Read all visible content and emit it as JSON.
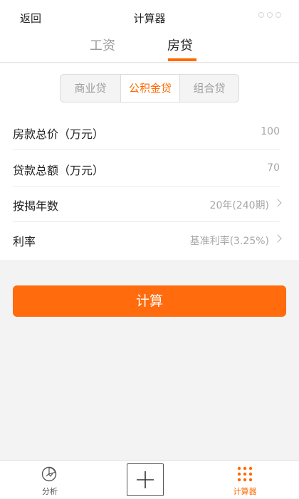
{
  "nav": {
    "back_label": "返回",
    "title": "计算器"
  },
  "tabs": [
    {
      "label": "工资",
      "active": false
    },
    {
      "label": "房贷",
      "active": true
    }
  ],
  "loan_types": [
    {
      "label": "商业贷",
      "selected": false
    },
    {
      "label": "公积金贷",
      "selected": true
    },
    {
      "label": "组合贷",
      "selected": false
    }
  ],
  "form": {
    "rows": [
      {
        "label": "房款总价（万元）",
        "value": "100",
        "has_arrow": false
      },
      {
        "label": "贷款总额（万元）",
        "value": "70",
        "has_arrow": false
      },
      {
        "label": "按揭年数",
        "value": "20年(240期)",
        "has_arrow": true
      },
      {
        "label": "利率",
        "value": "基准利率(3.25%)",
        "has_arrow": true
      }
    ]
  },
  "action": {
    "calculate_label": "计算"
  },
  "bottom_nav": {
    "analysis_label": "分析",
    "calculator_label": "计算器",
    "active": "计算器"
  },
  "colors": {
    "accent": "#ff6a00",
    "button": "#ff6b0d",
    "background": "#f3f3f3"
  }
}
